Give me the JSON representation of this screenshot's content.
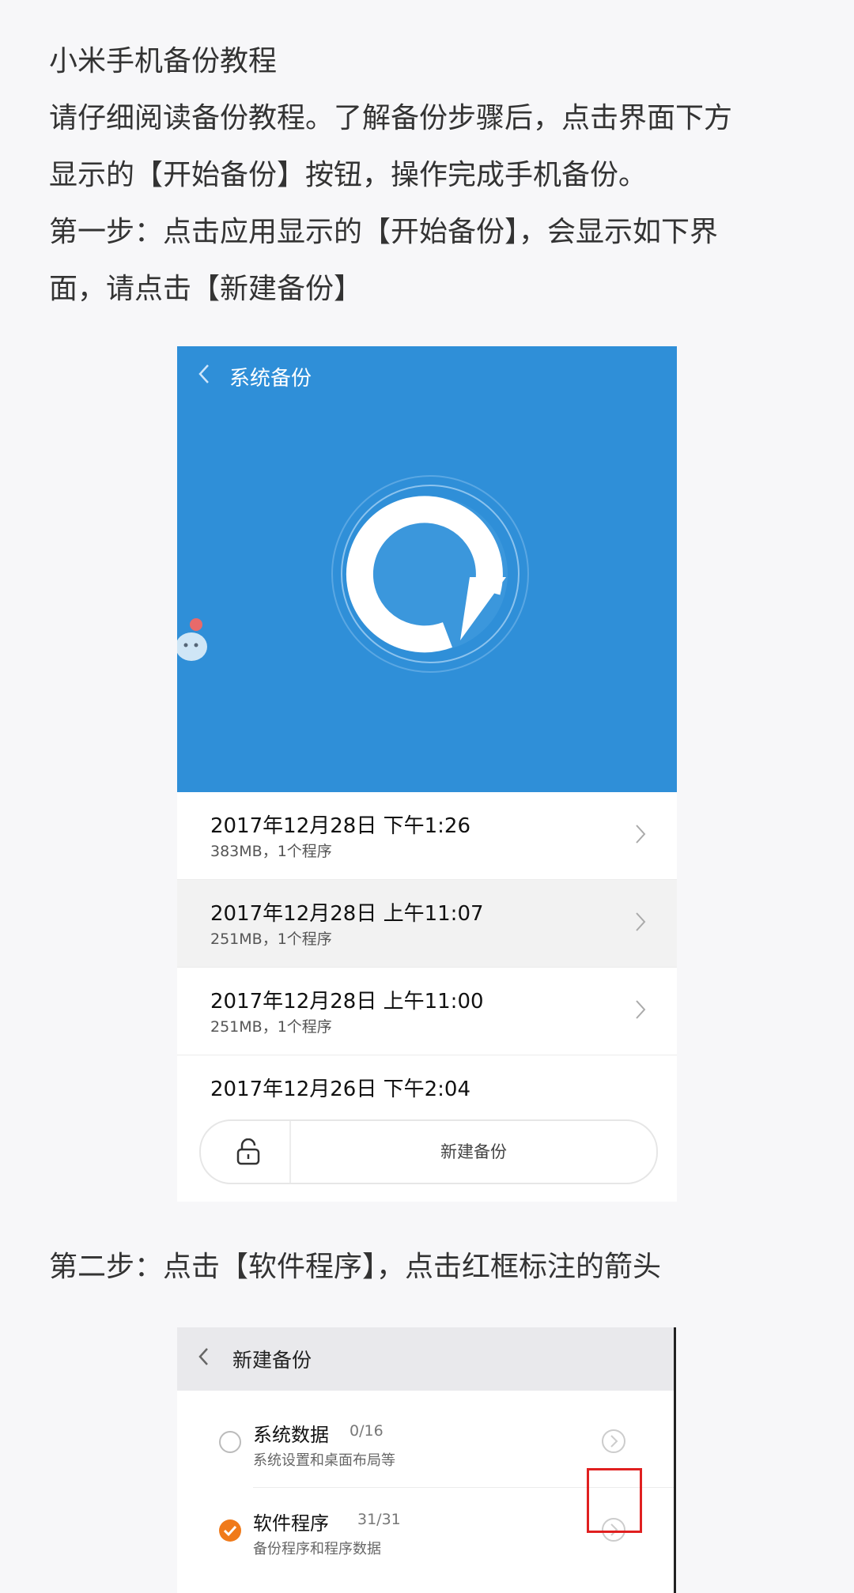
{
  "article": {
    "title": "小米手机备份教程",
    "intro_line1": "请仔细阅读备份教程。了解备份步骤后，点击界面下方",
    "intro_line2": "显示的【开始备份】按钮，操作完成手机备份。",
    "step1_line1": "第一步：点击应用显示的【开始备份】，会显示如下界",
    "step1_line2": "面，请点击【新建备份】",
    "step2": "第二步：点击【软件程序】，点击红框标注的箭头"
  },
  "screenshot1": {
    "title": "系统备份",
    "accent_color": "#2f8fd8",
    "backups": [
      {
        "date": "2017年12月28日 下午1:26",
        "detail": "383MB，1个程序"
      },
      {
        "date": "2017年12月28日 上午11:07",
        "detail": "251MB，1个程序"
      },
      {
        "date": "2017年12月28日 上午11:00",
        "detail": "251MB，1个程序"
      },
      {
        "date": "2017年12月26日 下午2:04"
      }
    ],
    "new_backup_label": "新建备份"
  },
  "screenshot2": {
    "title": "新建备份",
    "items": [
      {
        "name": "系统数据",
        "count": "0/16",
        "desc": "系统设置和桌面布局等",
        "checked": false
      },
      {
        "name": "软件程序",
        "count": "31/31",
        "desc": "备份程序和程序数据",
        "checked": true
      }
    ],
    "check_color": "#f07a1a",
    "highlight_color": "#e02020"
  }
}
